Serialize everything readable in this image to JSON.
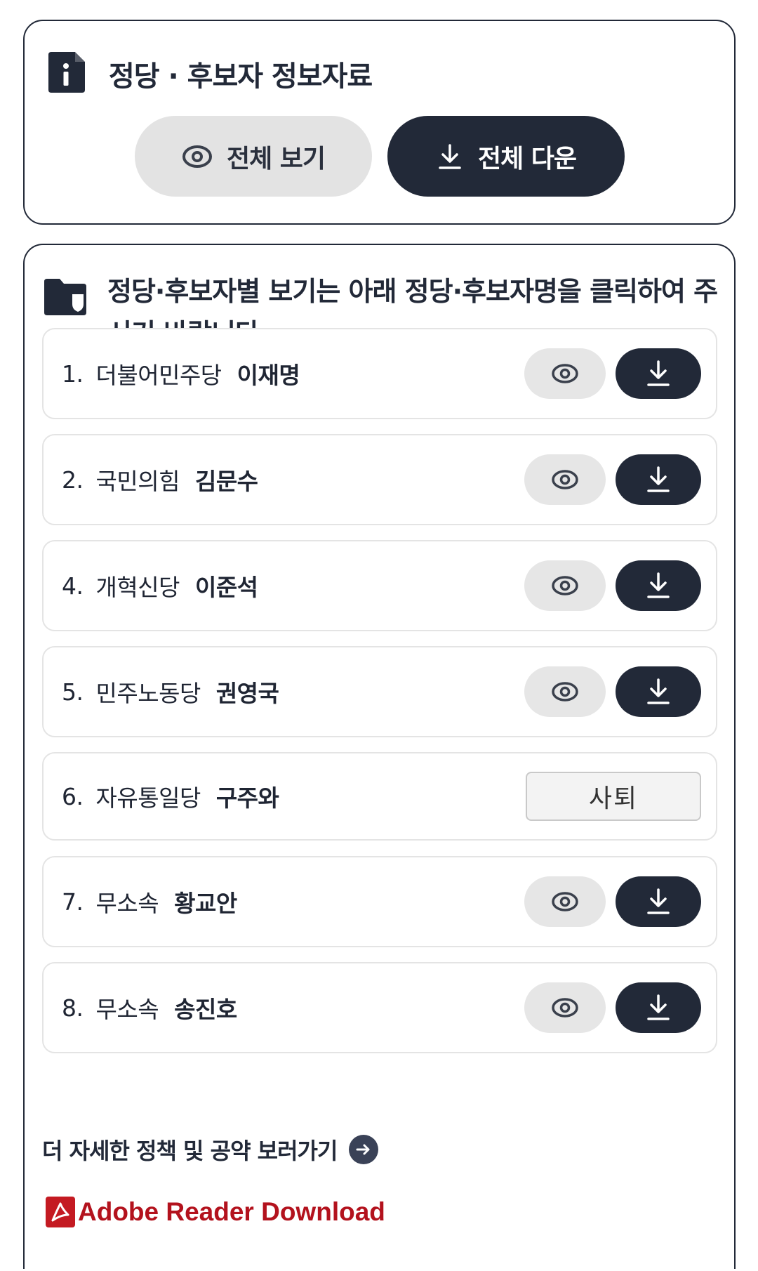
{
  "info_card": {
    "title": "정당 · 후보자 정보자료",
    "view_all_label": "전체 보기",
    "download_all_label": "전체 다운"
  },
  "party_card": {
    "heading": "정당·후보자별 보기는 아래 정당·후보자명을 클릭하여 주시기 바랍니다.",
    "rows": [
      {
        "num": "1.",
        "party": "더불어민주당",
        "candidate": "이재명",
        "status": "active"
      },
      {
        "num": "2.",
        "party": "국민의힘",
        "candidate": "김문수",
        "status": "active"
      },
      {
        "num": "4.",
        "party": "개혁신당",
        "candidate": "이준석",
        "status": "active"
      },
      {
        "num": "5.",
        "party": "민주노동당",
        "candidate": "권영국",
        "status": "active"
      },
      {
        "num": "6.",
        "party": "자유통일당",
        "candidate": "구주와",
        "status": "withdrawn",
        "status_label": "사퇴"
      },
      {
        "num": "7.",
        "party": "무소속",
        "candidate": "황교안",
        "status": "active"
      },
      {
        "num": "8.",
        "party": "무소속",
        "candidate": "송진호",
        "status": "active"
      }
    ],
    "more_link_label": "더 자세한 정책 및 공약 보러가기",
    "adobe_link_label": "Adobe Reader Download"
  },
  "icons": {
    "info": "document-info-icon",
    "folder": "folder-shield-icon",
    "view": "eye-icon",
    "download": "download-icon",
    "more": "arrow-right-circle-icon",
    "pdf": "adobe-pdf-icon"
  },
  "colors": {
    "dark_navy": "#222938",
    "light_gray": "#e3e3e3",
    "adobe_red": "#b3121d"
  }
}
